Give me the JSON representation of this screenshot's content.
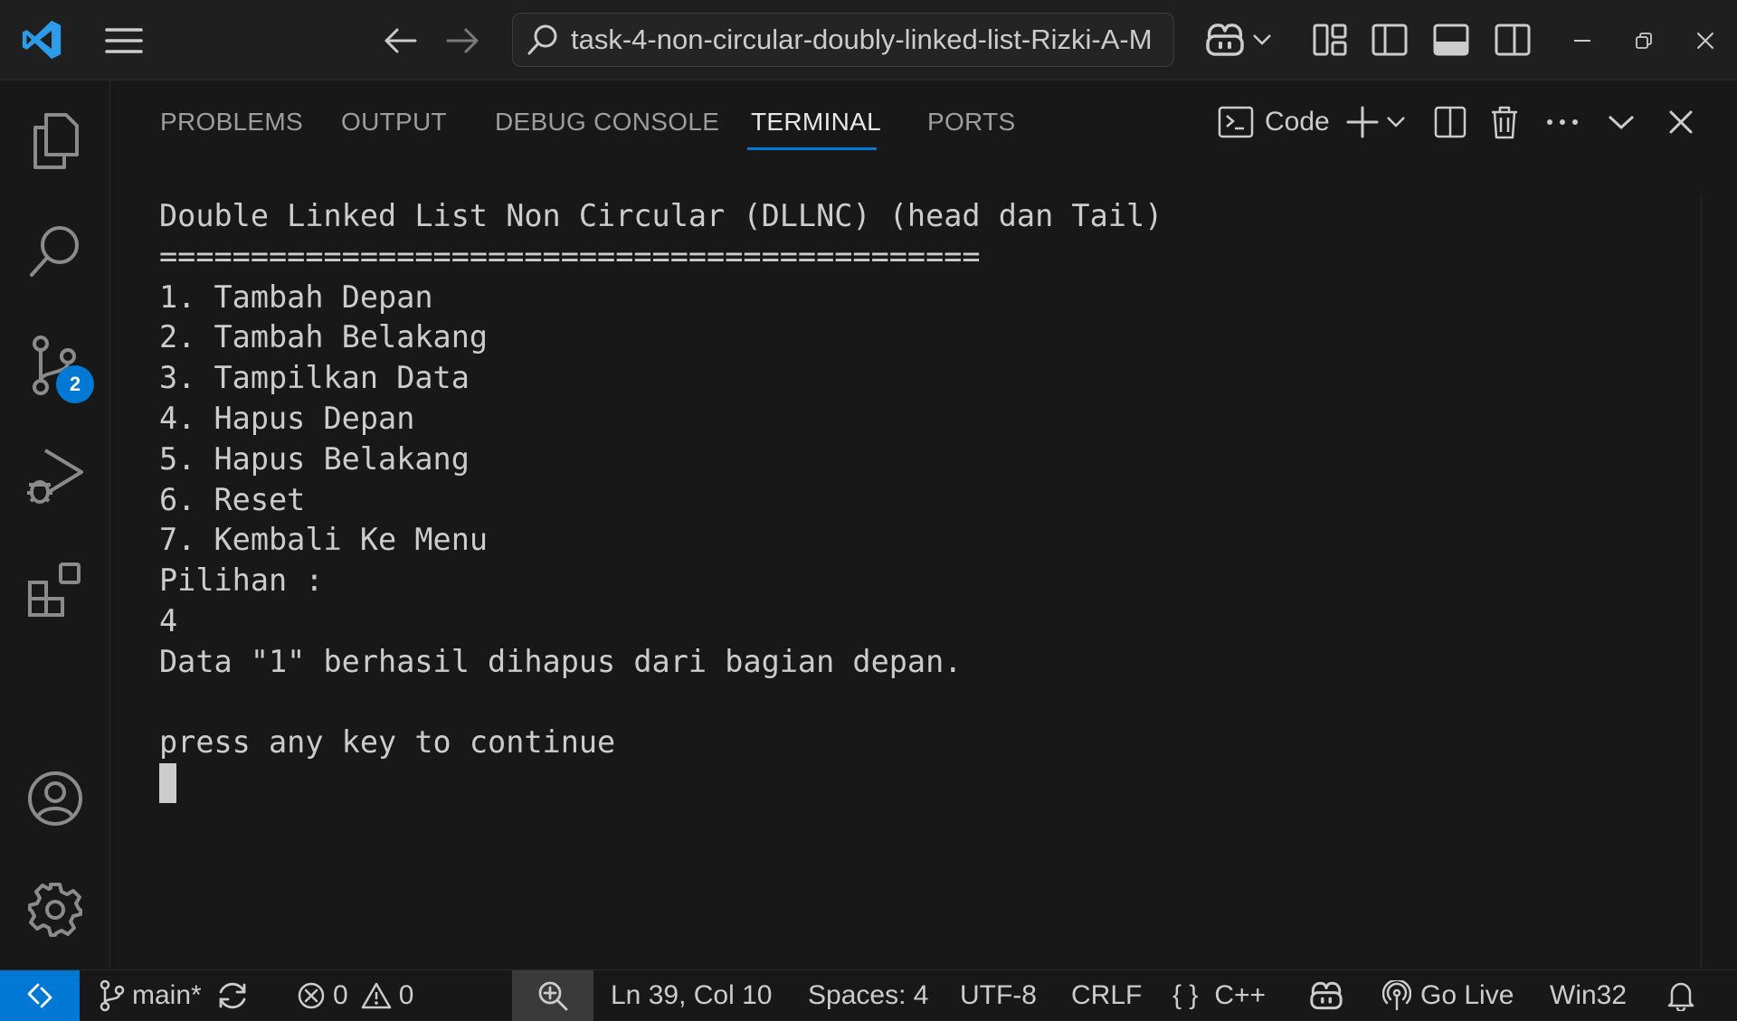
{
  "titlebar": {
    "search_text": "task-4-non-circular-doubly-linked-list-Rizki-A-M",
    "icons": [
      "vscode-logo-icon",
      "menu-icon",
      "back-arrow-icon",
      "forward-arrow-icon",
      "search-icon",
      "copilot-icon",
      "chevron-down-icon",
      "customize-layout-icon",
      "toggle-primary-sidebar-icon",
      "toggle-panel-icon",
      "toggle-secondary-sidebar-icon",
      "minimize-icon",
      "restore-icon",
      "close-icon"
    ]
  },
  "activitybar": {
    "items": [
      "explorer-icon",
      "search-icon",
      "source-control-icon",
      "run-debug-icon",
      "extensions-icon",
      "accounts-icon",
      "manage-gear-icon"
    ],
    "source_control_badge": "2"
  },
  "panel": {
    "tabs": [
      {
        "label": "PROBLEMS"
      },
      {
        "label": "OUTPUT"
      },
      {
        "label": "DEBUG CONSOLE"
      },
      {
        "label": "TERMINAL"
      },
      {
        "label": "PORTS"
      }
    ],
    "active_tab": "TERMINAL",
    "terminal_name": "Code",
    "accent": "#0078d4"
  },
  "terminal": {
    "lines": [
      "Double Linked List Non Circular (DLLNC) (head dan Tail)",
      "=============================================",
      "1. Tambah Depan",
      "2. Tambah Belakang",
      "3. Tampilkan Data",
      "4. Hapus Depan",
      "5. Hapus Belakang",
      "6. Reset",
      "7. Kembali Ke Menu",
      "Pilihan :",
      "4",
      "Data \"1\" berhasil dihapus dari bagian depan.",
      "",
      "press any key to continue"
    ]
  },
  "statusbar": {
    "branch": "main*",
    "errors": "0",
    "warnings": "0",
    "position": "Ln 39, Col 10",
    "spaces": "Spaces: 4",
    "encoding": "UTF-8",
    "eol": "CRLF",
    "language": "C++",
    "language_braces": "{ }",
    "go_live": "Go Live",
    "platform": "Win32",
    "remote_color": "#0078d4"
  }
}
